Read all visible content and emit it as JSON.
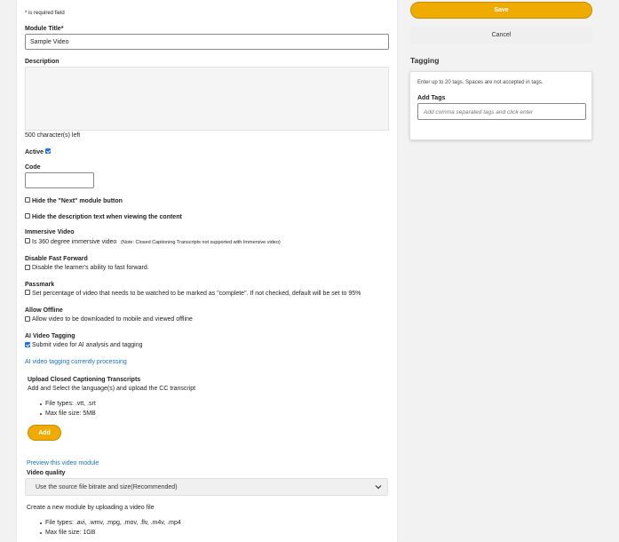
{
  "form": {
    "required_note": "* is required field",
    "module_title_label": "Module Title*",
    "module_title_value": "Sample Video",
    "description_label": "Description",
    "char_left": "500 character(s) left",
    "active_label": "Active",
    "code_label": "Code",
    "hide_next_label": "Hide the \"Next\" module button",
    "hide_desc_label": "Hide the description text when viewing the content",
    "immersive_heading": "Immersive Video",
    "immersive_label": "Is 360 degree immersive video",
    "immersive_note": "(Note: Closed Captioning Transcripts not supported with Immersive video)",
    "fastforward_heading": "Disable Fast Forward",
    "fastforward_label": "Disable the learner's ability to fast forward.",
    "passmark_heading": "Passmark",
    "passmark_label": "Set percentage of video that needs to be watched to be marked as \"complete\". If not checked, default will be set to 95%",
    "offline_heading": "Allow Offline",
    "offline_label": "Allow video to be downloaded to mobile and viewed offline",
    "ai_heading": "AI Video Tagging",
    "ai_label": "Submit video for AI analysis and tagging",
    "ai_processing": "AI video tagging currently processing",
    "cc_heading": "Upload Closed Captioning Transcripts",
    "cc_desc": "Add and Select the language(s) and upload the CC transcript",
    "cc_filetypes": "File types: .vtt, .srt",
    "cc_maxsize": "Max file size: 5MB",
    "add_button": "Add",
    "preview_link": "Preview this video module",
    "quality_label": "Video quality",
    "quality_selected": "Use the source file bitrate and size(Recommended)",
    "upload_desc": "Create a new module by uploading a video file",
    "video_filetypes": "File types: .avi, .wmv, .mpg, .mov, .flv, .m4v, .mp4",
    "video_maxsize": "Max file size: 1GB",
    "checks": {
      "active": true,
      "ai": true
    }
  },
  "sidebar": {
    "save_label": "Save",
    "cancel_label": "Cancel",
    "tagging_heading": "Tagging",
    "tagging_hint": "Enter up to 20 tags. Spaces are not accepted in tags.",
    "add_tags_label": "Add Tags",
    "tags_placeholder": "Add comma separated tags and click enter"
  },
  "colors": {
    "accent": "#f0ab00",
    "link": "#1a6fc2",
    "checkbox": "#1a73e8"
  }
}
